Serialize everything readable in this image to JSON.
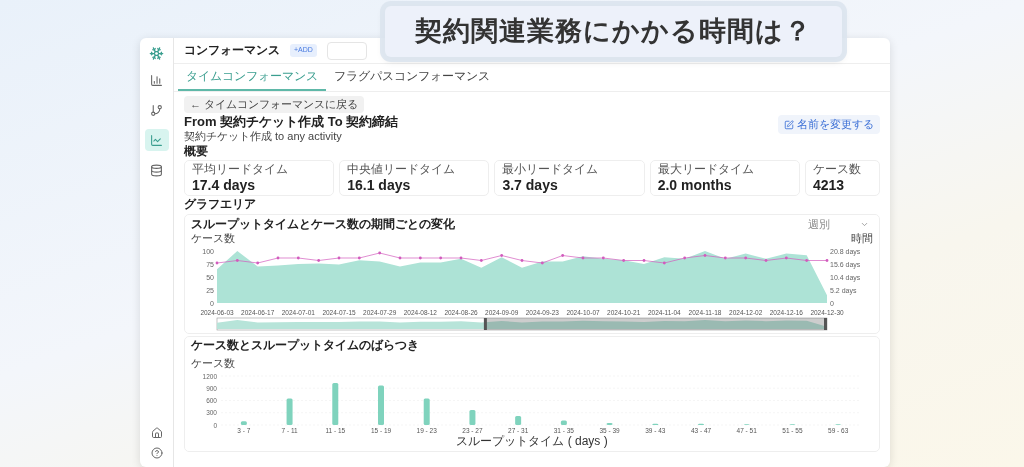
{
  "callout": {
    "text": "契約関連業務にかかる時間は？"
  },
  "sidebar": {
    "items": [
      {
        "kind": "bars",
        "selected": false
      },
      {
        "kind": "branch",
        "selected": false
      },
      {
        "kind": "chart",
        "selected": true
      },
      {
        "kind": "database",
        "selected": false
      }
    ],
    "footer_items": [
      {
        "kind": "home"
      },
      {
        "kind": "help"
      }
    ]
  },
  "header": {
    "title": "コンフォーマンス",
    "add_chip": "+ADD"
  },
  "tabs": [
    {
      "label": "タイムコンフォーマンス",
      "selected": true
    },
    {
      "label": "フラグパスコンフォーマンス",
      "selected": false
    }
  ],
  "back_button": {
    "arrow": "←",
    "label": "タイムコンフォーマンスに戻る"
  },
  "page_title": "From 契約チケット作成 To 契約締結",
  "subtitle": "契約チケット作成 to any activity",
  "rename_button": "名前を変更する",
  "summary": {
    "heading": "概要",
    "stats": [
      {
        "label": "平均リードタイム",
        "value": "17.4 days"
      },
      {
        "label": "中央値リードタイム",
        "value": "16.1 days"
      },
      {
        "label": "最小リードタイム",
        "value": "3.7 days"
      },
      {
        "label": "最大リードタイム",
        "value": "2.0 months"
      },
      {
        "label": "ケース数",
        "value": "4213"
      }
    ]
  },
  "graph_area": {
    "heading": "グラフエリア",
    "trend_card": {
      "period_dropdown": "週別",
      "chart_data": {
        "type": "area",
        "title": "スループットタイムとケース数の期間ごとの変化",
        "ylabel": "ケース数",
        "y2label": "時間",
        "categories": [
          "2024-06-03",
          null,
          "2024-06-17",
          null,
          "2024-07-01",
          null,
          "2024-07-15",
          null,
          "2024-07-29",
          null,
          "2024-08-12",
          null,
          "2024-08-26",
          null,
          "2024-09-09",
          null,
          "2024-09-23",
          null,
          "2024-10-07",
          null,
          "2024-10-21",
          null,
          "2024-11-04",
          null,
          "2024-11-18",
          null,
          "2024-12-02",
          null,
          "2024-12-16",
          null,
          "2024-12-30"
        ],
        "ylim": [
          0,
          100
        ],
        "yticks": [
          0,
          25,
          50,
          75,
          100
        ],
        "y2lim": [
          0,
          20.8
        ],
        "y2ticks": [
          {
            "value": 0,
            "label": "0"
          },
          {
            "value": 5.2,
            "label": "5.2 days"
          },
          {
            "value": 10.4,
            "label": "10.4 days"
          },
          {
            "value": 15.6,
            "label": "15.6 days"
          },
          {
            "value": 20.8,
            "label": "20.8 days"
          }
        ],
        "series": [
          {
            "color": "#ade3d6",
            "values": [
              65,
              100,
              70,
              72,
              75,
              76,
              74,
              82,
              80,
              70,
              78,
              78,
              85,
              68,
              88,
              68,
              80,
              80,
              90,
              85,
              82,
              75,
              88,
              85,
              100,
              85,
              95,
              85,
              95,
              92,
              15
            ]
          },
          {
            "type": "line",
            "axis": "y2",
            "color": "#d25bbd",
            "values": [
              16,
              17,
              16,
              18,
              18,
              17,
              18,
              18,
              20,
              18,
              18,
              18,
              18,
              17,
              19,
              17,
              16,
              19,
              18,
              18,
              17,
              17,
              16,
              18,
              19,
              18,
              18,
              17,
              18,
              17,
              17
            ]
          }
        ]
      }
    },
    "distribution_card": {
      "chart_data": {
        "type": "bar",
        "title": "ケース数とスループットタイムのばらつき",
        "ylabel": "ケース数",
        "xlabel": "スループットタイム ( days )",
        "color": "#7fd3bd",
        "categories": [
          "3 - 7",
          "7 - 11",
          "11 - 15",
          "15 - 19",
          "19 - 23",
          "23 - 27",
          "27 - 31",
          "31 - 35",
          "35 - 39",
          "39 - 43",
          "43 - 47",
          "47 - 51",
          "51 - 55",
          "59 - 63"
        ],
        "values": [
          90,
          650,
          1030,
          970,
          650,
          370,
          220,
          110,
          50,
          30,
          30,
          20,
          20,
          20
        ],
        "ylim": [
          0,
          1200
        ],
        "yticks": [
          0,
          300,
          600,
          900,
          1200
        ],
        "grid": true
      }
    }
  }
}
